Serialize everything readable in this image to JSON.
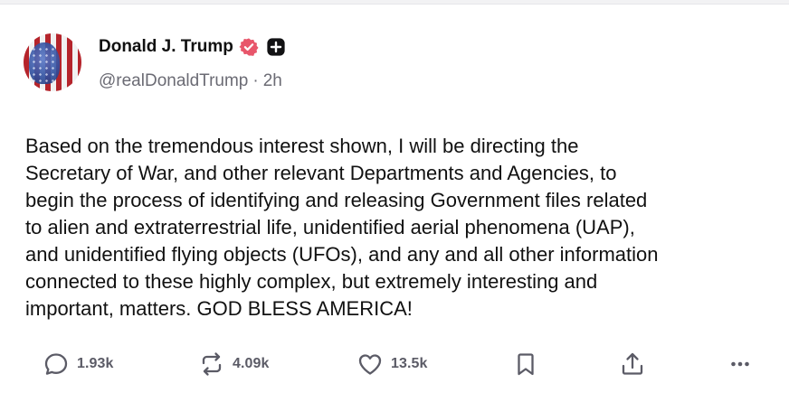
{
  "post": {
    "author": {
      "name": "Donald J. Trump",
      "handle": "@realDonaldTrump",
      "separator": "·",
      "time": "2h",
      "verified_icon": "verified-badge-icon",
      "badge_icon": "plus-badge-icon"
    },
    "text": "Based on the tremendous interest shown, I will be directing the\nSecretary of War, and other relevant Departments and Agencies, to\nbegin the process of identifying and releasing Government files related\nto alien and extraterrestrial life, unidentified aerial phenomena (UAP),\nand unidentified flying objects (UFOs), and any and all other information\nconnected to these highly complex, but extremely interesting and\nimportant, matters. GOD BLESS AMERICA!"
  },
  "actions": {
    "replies": {
      "icon": "comment-icon",
      "count": "1.93k"
    },
    "reposts": {
      "icon": "repost-icon",
      "count": "4.09k"
    },
    "likes": {
      "icon": "heart-icon",
      "count": "13.5k"
    },
    "bookmark": {
      "icon": "bookmark-icon"
    },
    "share": {
      "icon": "share-icon"
    },
    "more": {
      "icon": "more-icon"
    }
  },
  "colors": {
    "verified": "#e8566b",
    "muted_text": "#6b6b74",
    "icon_gray": "#5b5b66"
  }
}
